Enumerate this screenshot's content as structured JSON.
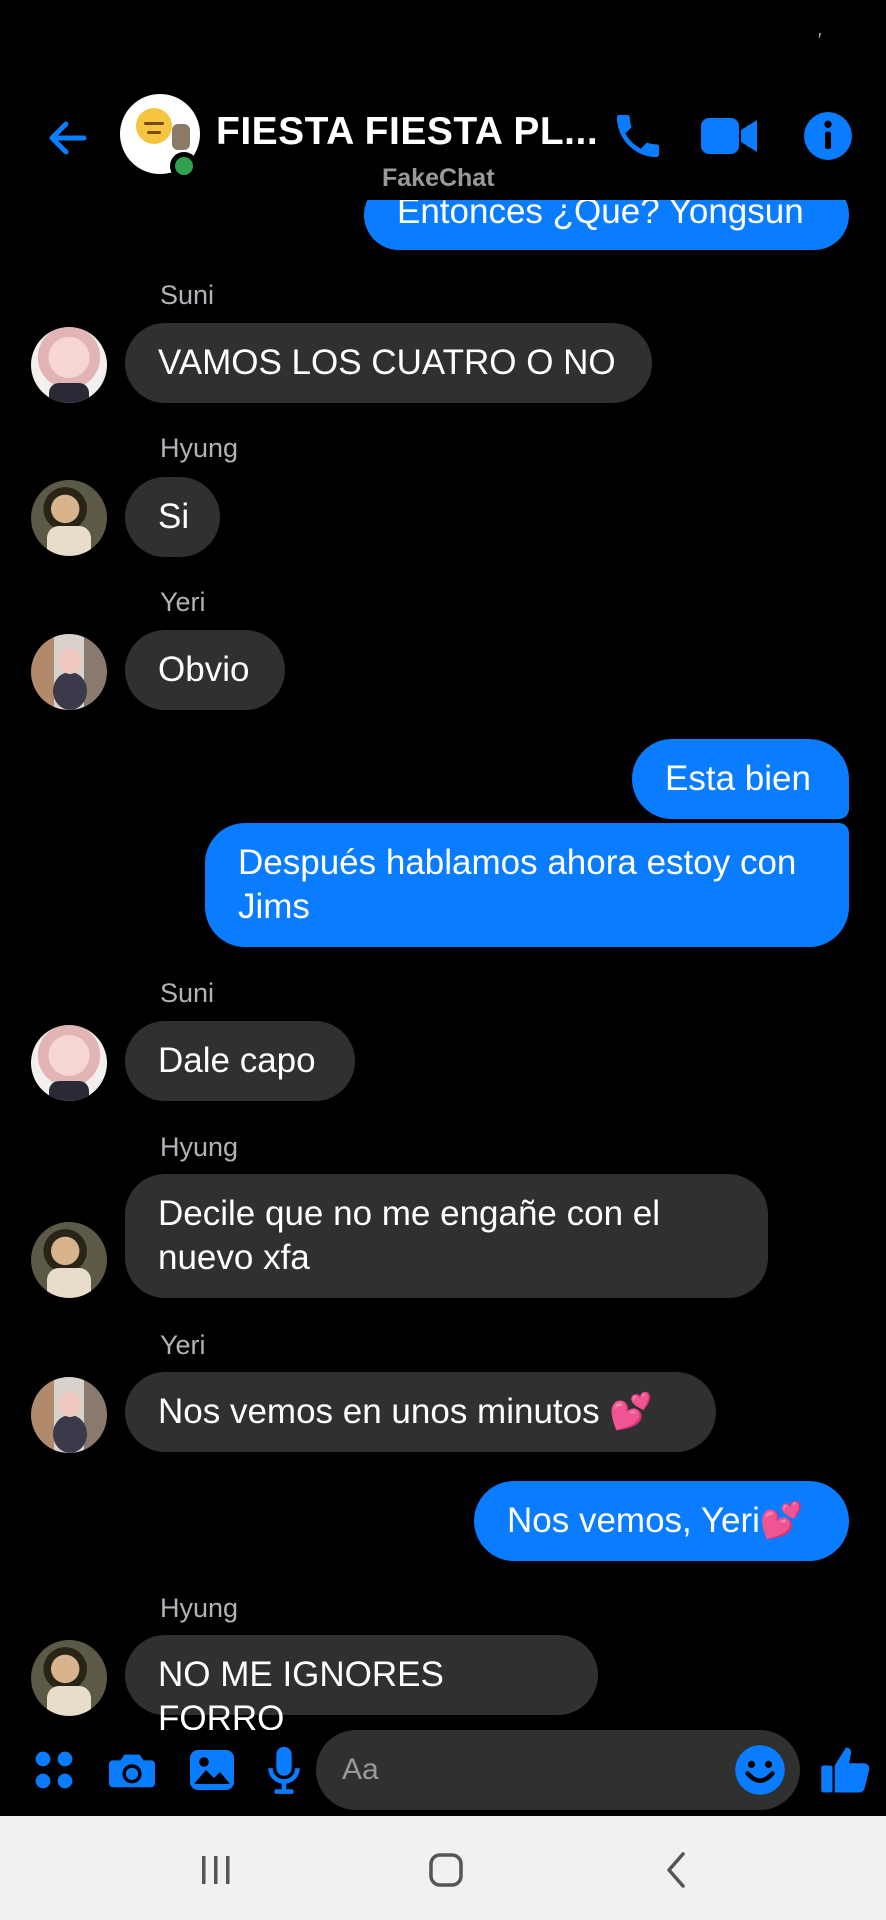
{
  "status_bar": {
    "indicator": "′"
  },
  "header": {
    "title": "FIESTA FIESTA PL...",
    "watermark": "FakeChat",
    "accent_color": "#0a7cff",
    "icons": [
      "back-arrow-icon",
      "phone-icon",
      "video-camera-icon",
      "info-icon"
    ]
  },
  "messages": [
    {
      "type": "out",
      "text": "Entonces ¿Que? Yongsun"
    },
    {
      "type": "in",
      "sender": "Suni",
      "text": "VAMOS LOS CUATRO O NO"
    },
    {
      "type": "in",
      "sender": "Hyung",
      "text": "Si"
    },
    {
      "type": "in",
      "sender": "Yeri",
      "text": "Obvio"
    },
    {
      "type": "out",
      "text": "Esta bien"
    },
    {
      "type": "out",
      "text": "Después hablamos ahora estoy con Jims"
    },
    {
      "type": "in",
      "sender": "Suni",
      "text": "Dale capo"
    },
    {
      "type": "in",
      "sender": "Hyung",
      "text": "Decile que no me engañe con el nuevo xfa"
    },
    {
      "type": "in",
      "sender": "Yeri",
      "text": "Nos vemos en unos minutos 💕"
    },
    {
      "type": "out",
      "text": "Nos vemos, Yeri💕"
    },
    {
      "type": "in",
      "sender": "Hyung",
      "text": "NO ME IGNORES FORRO"
    }
  ],
  "composer": {
    "placeholder": "Aa",
    "icons": [
      "apps-grid-icon",
      "camera-icon",
      "gallery-icon",
      "microphone-icon",
      "emoji-icon",
      "thumbs-up-icon"
    ]
  },
  "navbar": {
    "icons": [
      "recent-apps-icon",
      "home-icon",
      "back-icon"
    ]
  }
}
